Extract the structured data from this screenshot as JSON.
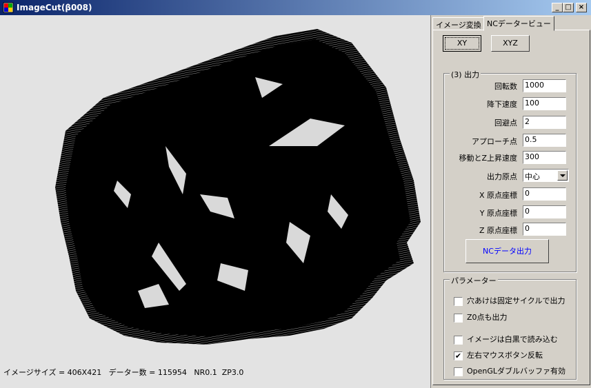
{
  "window": {
    "title": "ImageCut(β008)",
    "controls": {
      "minimize": "_",
      "maximize": "□",
      "close": "×"
    }
  },
  "tabs": [
    {
      "label": "イメージ変換",
      "active": false
    },
    {
      "label": "NCデータービュー",
      "active": true
    }
  ],
  "view_buttons": {
    "xy": "XY",
    "xyz": "XYZ"
  },
  "output": {
    "group_title": "(3) 出力",
    "fields": [
      {
        "label": "回転数",
        "value": "1000"
      },
      {
        "label": "降下速度",
        "value": "100"
      },
      {
        "label": "回避点",
        "value": "2"
      },
      {
        "label": "アプローチ点",
        "value": "0.5"
      },
      {
        "label": "移動とZ上昇速度",
        "value": "300"
      }
    ],
    "origin_label": "出力原点",
    "origin_value": "中心",
    "coords": [
      {
        "label": "X 原点座標",
        "value": "0"
      },
      {
        "label": "Y 原点座標",
        "value": "0"
      },
      {
        "label": "Z 原点座標",
        "value": "0"
      }
    ],
    "nc_button": "NCデータ出力"
  },
  "params": {
    "group_title": "パラメーター",
    "options": [
      {
        "label": "穴あけは固定サイクルで出力",
        "checked": false
      },
      {
        "label": "Z0点も出力",
        "checked": false
      },
      {
        "label": "イメージは白黒で読み込む",
        "checked": false
      },
      {
        "label": "左右マウスボタン反転",
        "checked": true
      },
      {
        "label": "OpenGLダブルバッファ有効",
        "checked": false
      }
    ],
    "check_mark": "✔"
  },
  "status_bar": "イメージサイズ = 406X421   データー数 = 115954   NR0.1  ZP3.0",
  "colors": {
    "title_start": "#0a246a",
    "title_end": "#a6caf0",
    "link_blue": "#0000ff"
  }
}
